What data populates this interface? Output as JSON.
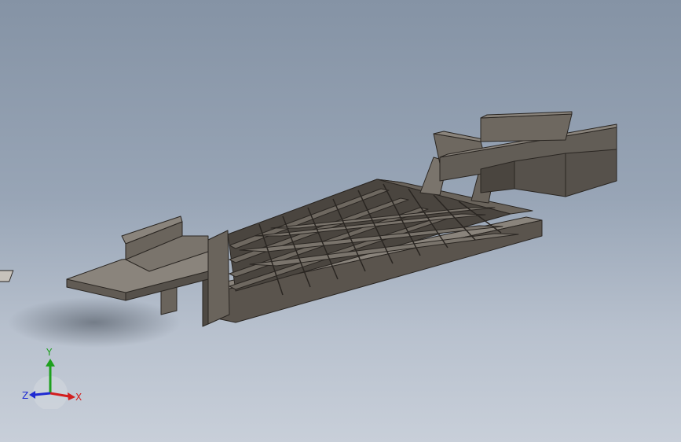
{
  "triad": {
    "x_label": "X",
    "y_label": "Y",
    "z_label": "Z",
    "x_color": "#d21e1e",
    "y_color": "#1ea01e",
    "z_color": "#1e2ad2"
  }
}
